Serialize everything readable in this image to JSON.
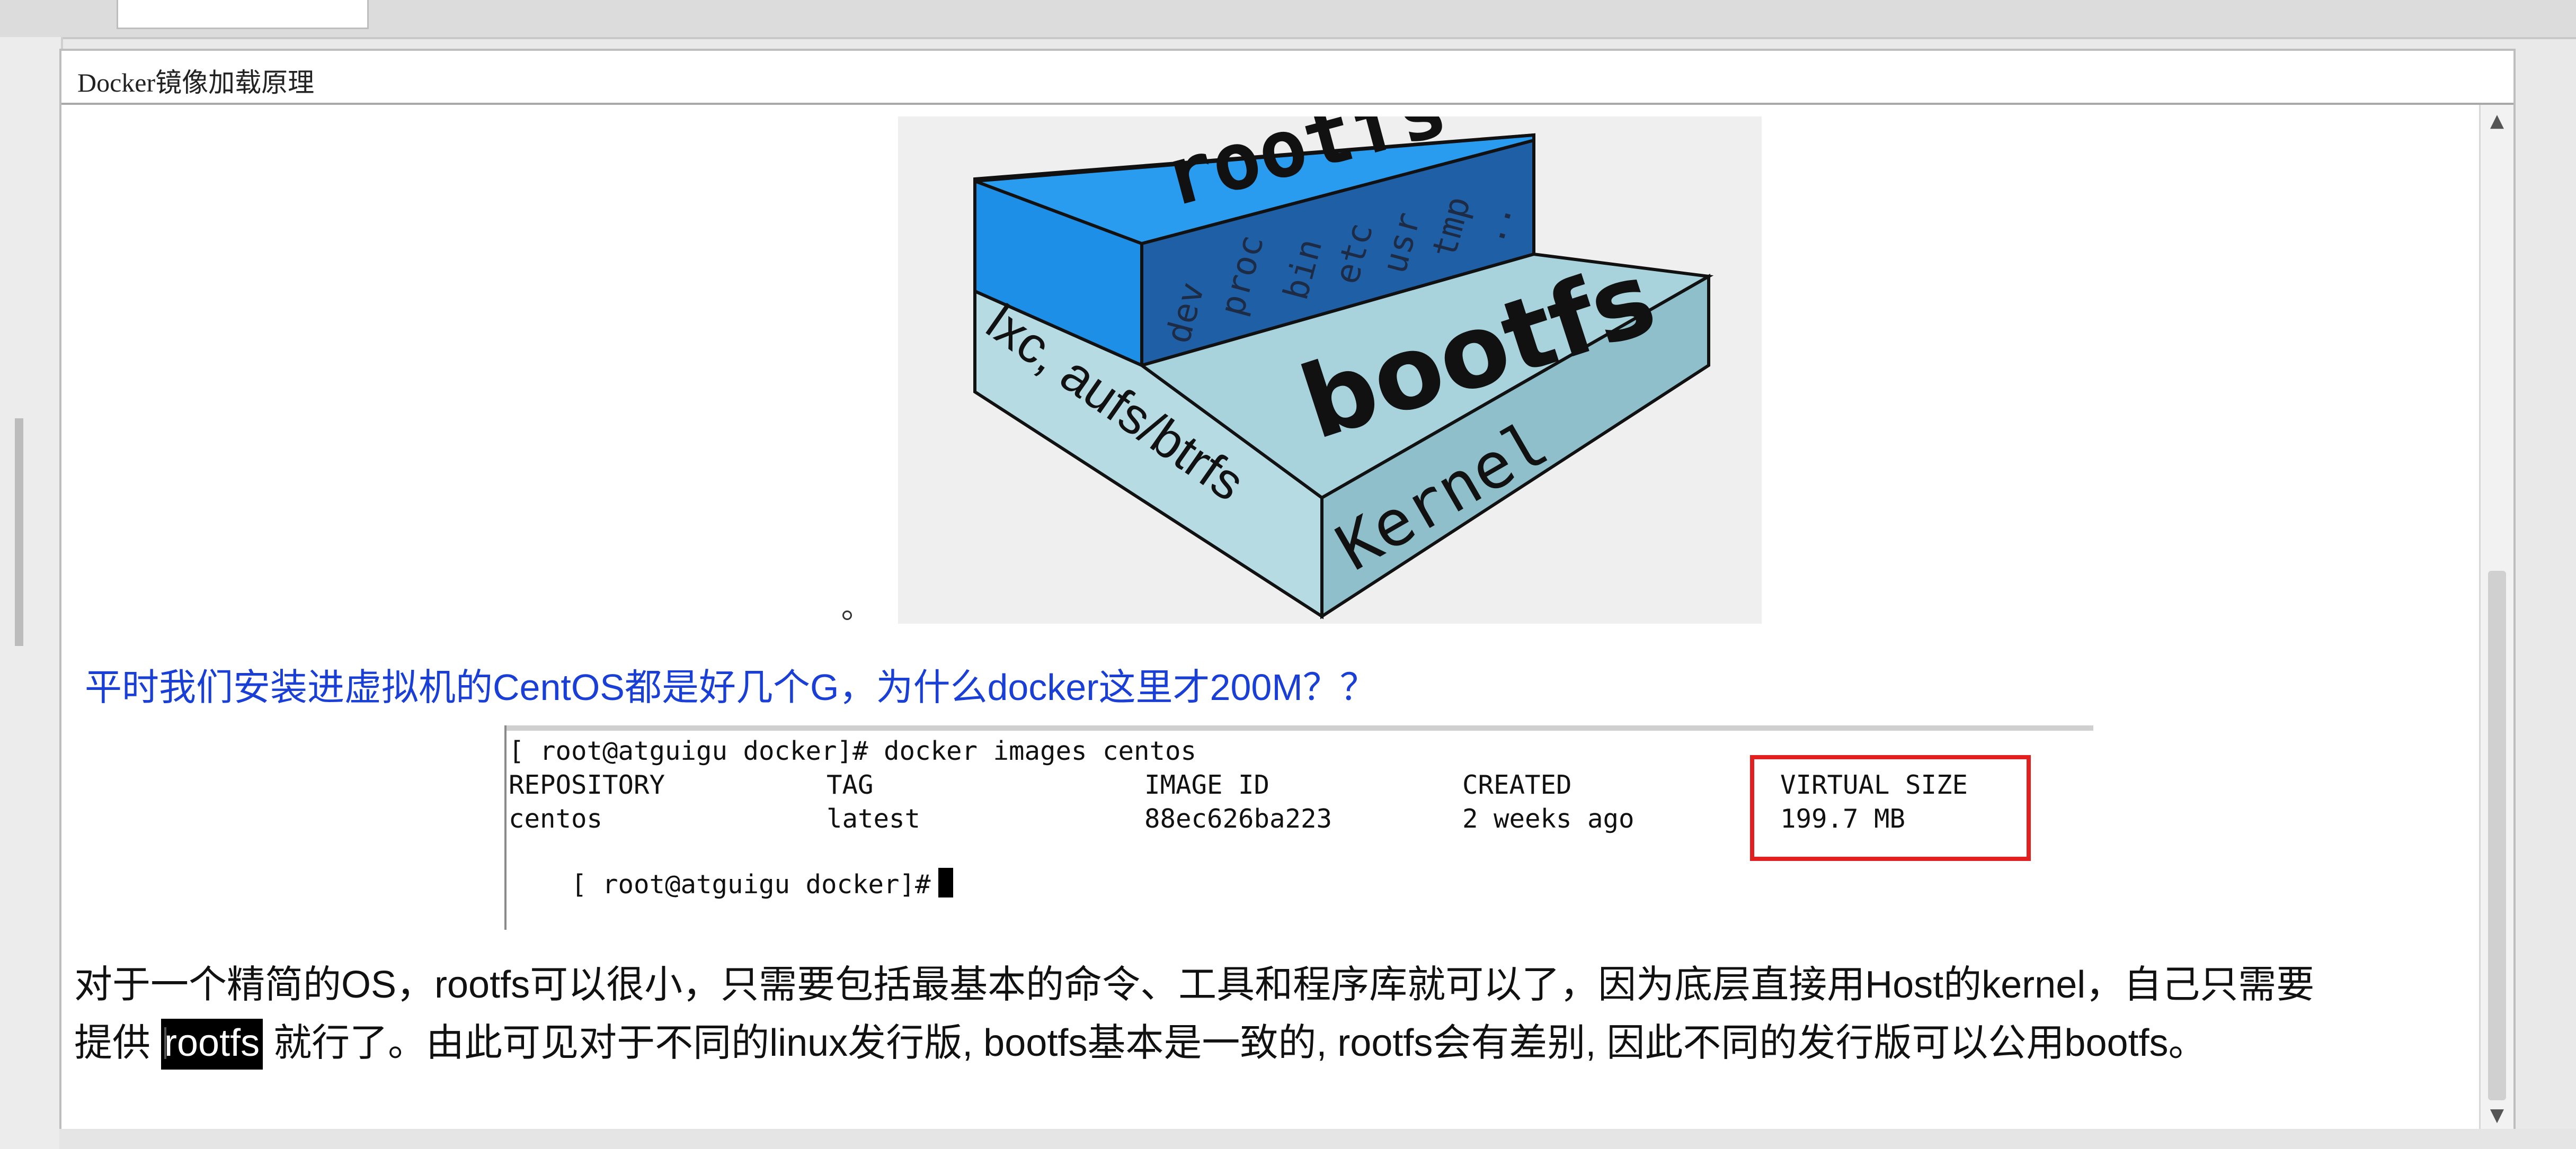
{
  "window": {
    "doc_title": "Docker镜像加载原理"
  },
  "diagram": {
    "rootfs_label": "rootfs",
    "rootfs_dirs": [
      "dev",
      "proc",
      "bin",
      "etc",
      "usr",
      "tmp",
      ".."
    ],
    "bootfs_label": "bootfs",
    "kernel_label": "Kernel",
    "side_label": "lxc, aufs/btrfs",
    "colors": {
      "rootfs_blue": "#1e8fe6",
      "rootfs_dark": "#1f5fa6",
      "bootfs_light": "#b6dbe3",
      "bootfs_side": "#8fbfca",
      "background": "#efefef"
    }
  },
  "question": "平时我们安装进虚拟机的CentOS都是好几个G，为什么docker这里才200M？？",
  "terminal": {
    "command_line": "[ root@atguigu docker]# docker images centos",
    "headers": [
      "REPOSITORY",
      "TAG",
      "IMAGE ID",
      "CREATED",
      "VIRTUAL SIZE"
    ],
    "row": [
      "centos",
      "latest",
      "88ec626ba223",
      "2 weeks ago",
      "199.7 MB"
    ],
    "prompt": "[ root@atguigu docker]#",
    "highlight_color": "#e32020"
  },
  "paragraph": {
    "line1": "对于一个精简的OS，rootfs可以很小，只需要包括最基本的命令、工具和程序库就可以了，因为底层直接用Host的kernel，自己只需要",
    "line2_prefix": "提供 ",
    "selected_word": "rootfs",
    "line2_suffix": " 就行了。由此可见对于不同的linux发行版, bootfs基本是一致的, rootfs会有差别, 因此不同的发行版可以公用bootfs。"
  }
}
